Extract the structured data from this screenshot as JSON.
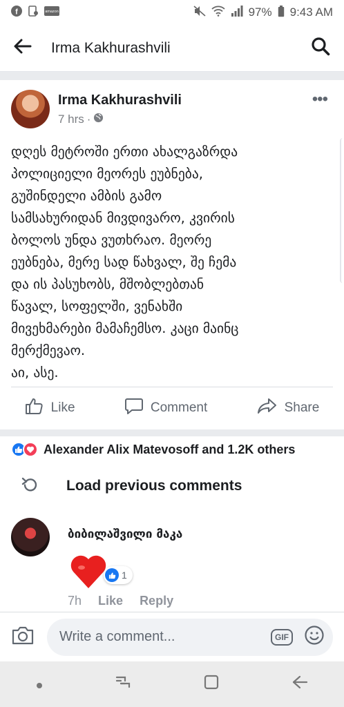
{
  "status_bar": {
    "battery": "97%",
    "time": "9:43 AM"
  },
  "header": {
    "title": "Irma Kakhurashvili"
  },
  "post": {
    "author": "Irma Kakhurashvili",
    "time": "7 hrs",
    "body_lines": [
      "დღეს მეტროში ერთი ახალგაზრდა",
      "პოლიციელი მეორეს ეუბნება,",
      "გუშინდელი ამბის გამო",
      "სამსახურიდან მივდივარო, კვირის",
      "ბოლოს უნდა ვუთხრაო. მეორე",
      "ეუბნება, მერე სად წახვალ, შე ჩემა",
      "და ის პასუხობს, მშობლებთან",
      "წავალ, სოფელში, ვენახში",
      "მივეხმარები მამაჩემსო. კაცი მაინც",
      "მერქმევაო.",
      "აი, ასე."
    ]
  },
  "actions": {
    "like": "Like",
    "comment": "Comment",
    "share": "Share"
  },
  "reactions_summary": "Alexander Alix Matevosoff and 1.2K others",
  "load_previous": "Load previous comments",
  "comment": {
    "author": "ბიბილაშვილი მაკა",
    "reaction_count": "1",
    "time": "7h",
    "like": "Like",
    "reply": "Reply"
  },
  "composer": {
    "placeholder": "Write a comment...",
    "gif": "GIF"
  },
  "colors": {
    "brand_blue": "#1877f2",
    "love_red": "#f33e58",
    "divider": "#e9ebee"
  }
}
